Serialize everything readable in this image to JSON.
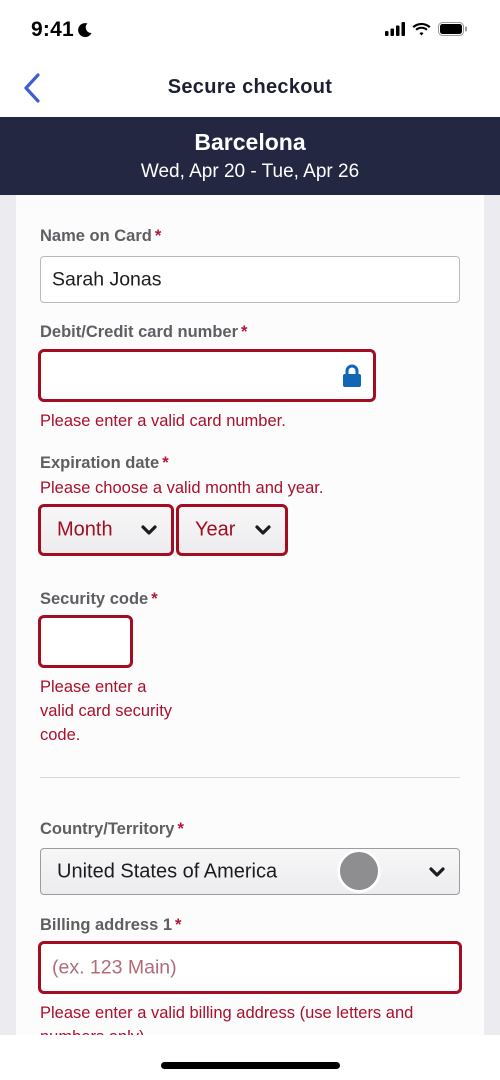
{
  "status_bar": {
    "time": "9:41",
    "icons": [
      "moon-icon",
      "cellular-signal-icon",
      "wifi-icon",
      "battery-icon"
    ]
  },
  "nav": {
    "back_icon": "chevron-left-icon",
    "title": "Secure checkout"
  },
  "trip": {
    "city": "Barcelona",
    "dates": "Wed, Apr 20 - Tue, Apr 26"
  },
  "form": {
    "required_marker": "*",
    "name_on_card": {
      "label": "Name on Card",
      "value": "Sarah Jonas"
    },
    "card_number": {
      "label": "Debit/Credit card number",
      "value": "",
      "icon": "lock-icon",
      "error": "Please enter a valid card number."
    },
    "expiration": {
      "label": "Expiration date",
      "error": "Please choose a valid month and year.",
      "month_selected": "Month",
      "year_selected": "Year"
    },
    "security_code": {
      "label": "Security code",
      "value": "",
      "error_lines": [
        "Please enter a",
        "valid card security",
        "code."
      ]
    },
    "country": {
      "label": "Country/Territory",
      "selected": "United States of America"
    },
    "billing_address_1": {
      "label": "Billing address 1",
      "placeholder": "(ex. 123 Main)",
      "error_lines": [
        "Please enter a valid billing address (use letters and",
        "numbers only)."
      ]
    }
  },
  "colors": {
    "header_bg": "#232742",
    "error": "#a30d22",
    "accent_blue": "#3f5fd1",
    "lock_blue": "#1166b8"
  }
}
